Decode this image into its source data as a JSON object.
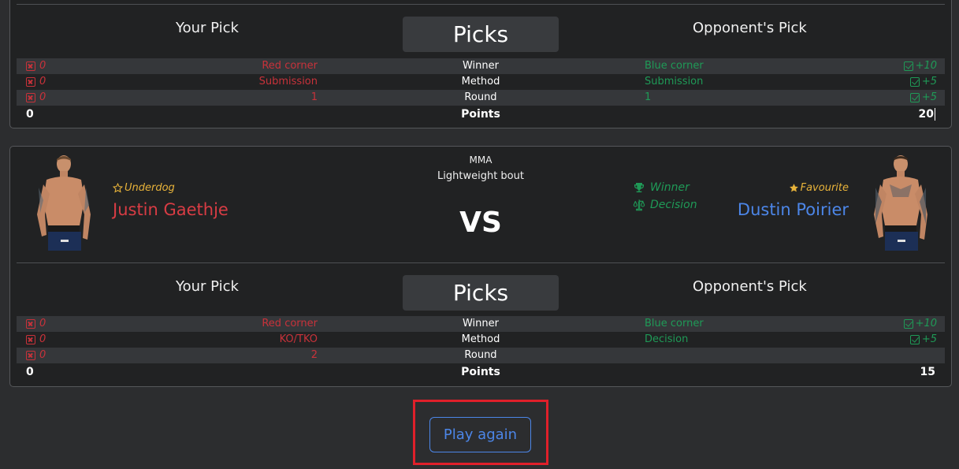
{
  "colors": {
    "red": "#c8323a",
    "green": "#1f9a57",
    "blue": "#4c86e8",
    "gold": "#e8b33a",
    "highlight": "#e0202a"
  },
  "bout1": {
    "headers": {
      "your_pick": "Your Pick",
      "picks": "Picks",
      "opponent_pick": "Opponent's Pick"
    },
    "rows": [
      {
        "lscore": "0",
        "lval": "Red corner",
        "label": "Winner",
        "rval": "Blue corner",
        "rscore": "+10"
      },
      {
        "lscore": "0",
        "lval": "Submission",
        "label": "Method",
        "rval": "Submission",
        "rscore": "+5"
      },
      {
        "lscore": "0",
        "lval": "1",
        "label": "Round",
        "rval": "1",
        "rscore": "+5"
      }
    ],
    "points": {
      "left": "0",
      "label": "Points",
      "right": "20"
    }
  },
  "bout2": {
    "sport": "MMA",
    "bout_type": "Lightweight bout",
    "vs": "VS",
    "left_fighter": {
      "tag": "Underdog",
      "name": "Justin Gaethje",
      "tag_icon": "star-outline-icon"
    },
    "right_fighter": {
      "tag": "Favourite",
      "name": "Dustin Poirier",
      "tag_icon": "star-filled-icon"
    },
    "result": {
      "winner": "Winner",
      "decision": "Decision"
    },
    "headers": {
      "your_pick": "Your Pick",
      "picks": "Picks",
      "opponent_pick": "Opponent's Pick"
    },
    "rows": [
      {
        "lscore": "0",
        "lval": "Red corner",
        "label": "Winner",
        "rval": "Blue corner",
        "rscore": "+10"
      },
      {
        "lscore": "0",
        "lval": "KO/TKO",
        "label": "Method",
        "rval": "Decision",
        "rscore": "+5"
      },
      {
        "lscore": "0",
        "lval": "2",
        "label": "Round",
        "rval": "",
        "rscore": ""
      }
    ],
    "points": {
      "left": "0",
      "label": "Points",
      "right": "15"
    }
  },
  "play_again": "Play again"
}
